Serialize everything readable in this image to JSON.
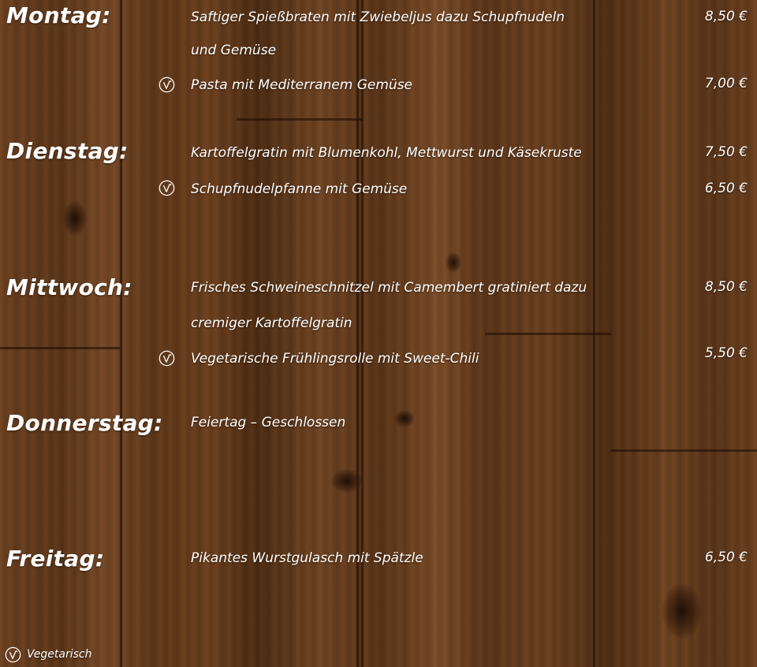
{
  "days": [
    {
      "label": "Montag:",
      "dishes": [
        {
          "line1": "Saftiger Spießbraten mit Zwiebeljus dazu Schupfnudeln",
          "line2": "und Gemüse",
          "price": "8,50 €",
          "vegetarian": false
        },
        {
          "line1": "Pasta mit Mediterranem Gemüse",
          "price": "7,00 €",
          "vegetarian": true
        }
      ]
    },
    {
      "label": "Dienstag:",
      "dishes": [
        {
          "line1": "Kartoffelgratin mit Blumenkohl, Mettwurst und Käsekruste",
          "price": "7,50 €",
          "vegetarian": false
        },
        {
          "line1": "Schupfnudelpfanne mit Gemüse",
          "price": "6,50 €",
          "vegetarian": true
        }
      ]
    },
    {
      "label": "Mittwoch:",
      "dishes": [
        {
          "line1": "Frisches Schweineschnitzel mit Camembert gratiniert dazu",
          "line2": "cremiger Kartoffelgratin",
          "price": "8,50 €",
          "vegetarian": false
        },
        {
          "line1": "Vegetarische Frühlingsrolle mit Sweet-Chili",
          "price": "5,50 €",
          "vegetarian": true
        }
      ]
    },
    {
      "label": "Donnerstag:",
      "dishes": [
        {
          "line1": "Feiertag – Geschlossen",
          "vegetarian": false
        }
      ]
    },
    {
      "label": "Freitag:",
      "dishes": [
        {
          "line1": "Pikantes Wurstgulasch mit Spätzle",
          "price": "6,50 €",
          "vegetarian": false
        }
      ]
    }
  ],
  "legend": {
    "icon": "vegetarian-icon",
    "label": "Vegetarisch"
  },
  "colors": {
    "text": "#ffffff",
    "wood": "#5a3519"
  }
}
